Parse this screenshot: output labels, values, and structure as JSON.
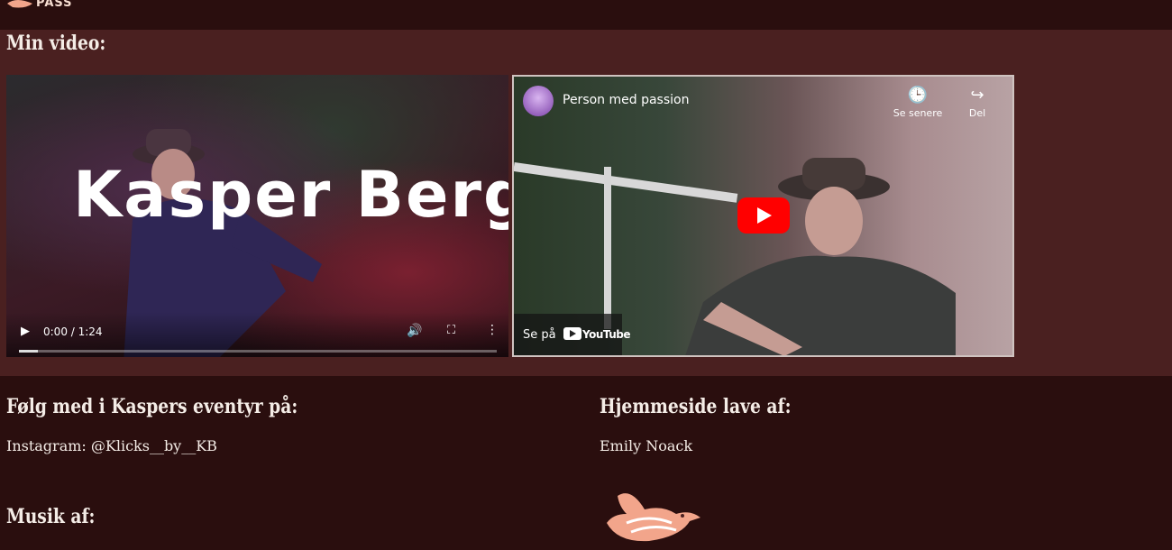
{
  "header": {
    "logo_text": "PASS"
  },
  "video_section": {
    "title": "Min video:",
    "player": {
      "overlay_title": "Kasper Berg",
      "time": "0:00 / 1:24",
      "progress_fraction": 0.04
    },
    "youtube": {
      "title": "Person med passion",
      "watch_later": "Se senere",
      "share": "Del",
      "watch_on": "Se på",
      "brand": "YouTube"
    }
  },
  "footer": {
    "follow_heading": "Følg med i Kaspers eventyr på:",
    "instagram": "Instagram: @Klicks__by__KB",
    "made_by_heading": "Hjemmeside lave af:",
    "made_by": "Emily Noack",
    "music_heading": "Musik af:"
  },
  "colors": {
    "page_bg": "#2a0e0e",
    "section_bg": "#4a2020",
    "text": "#f4ece6",
    "bird": "#f2a58b",
    "youtube_red": "#ff0000"
  }
}
